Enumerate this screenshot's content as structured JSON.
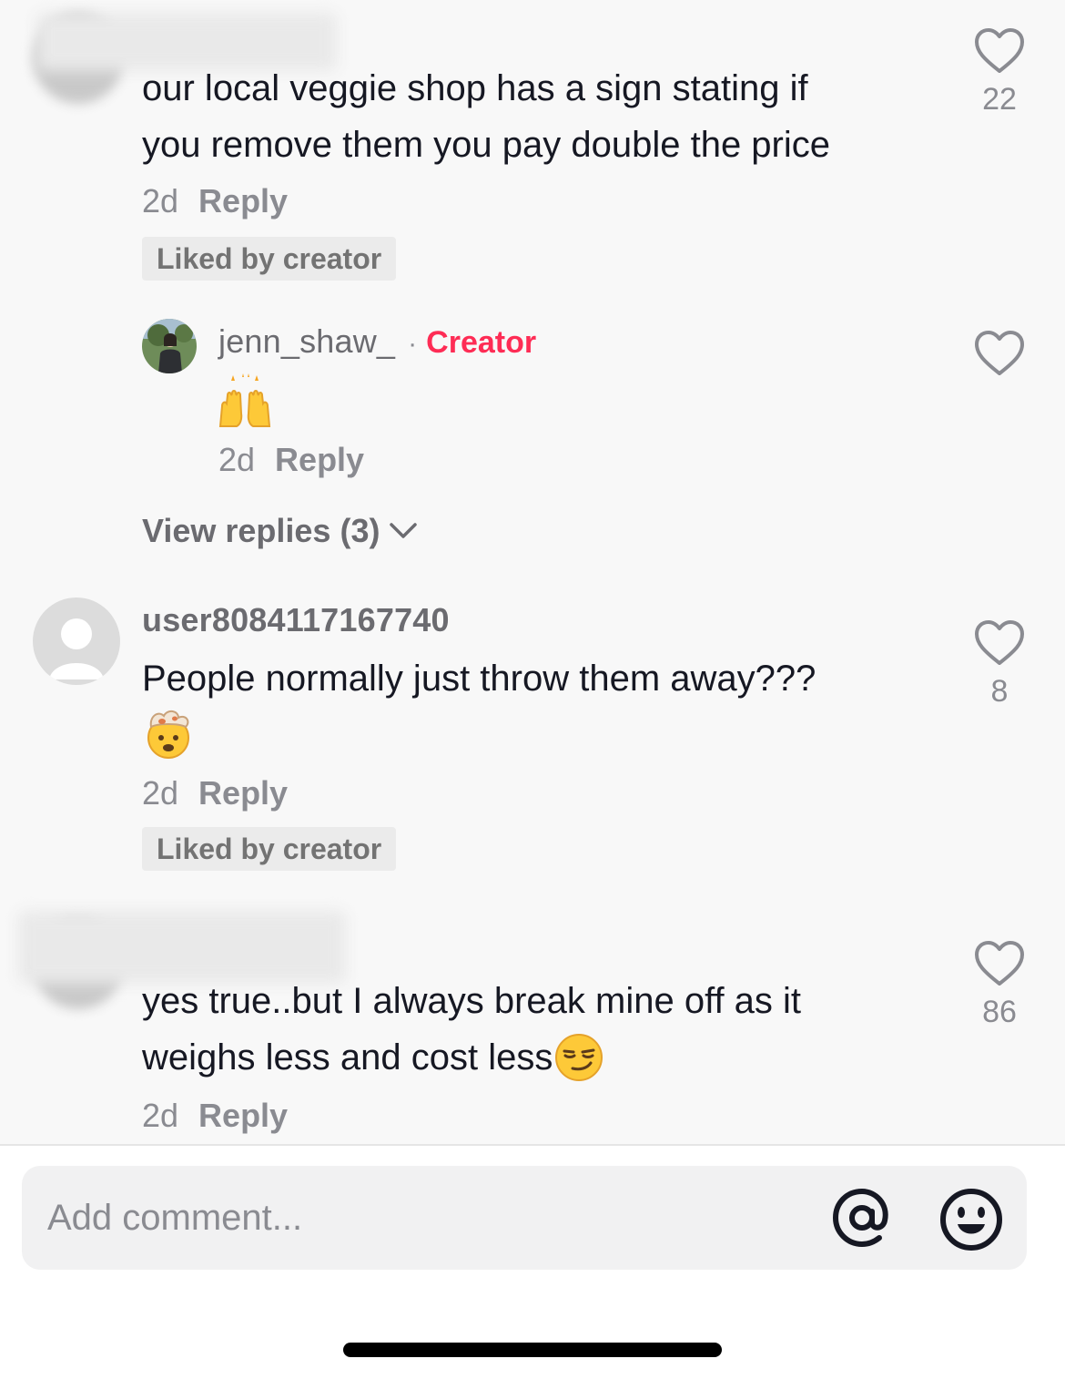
{
  "comments": [
    {
      "text_lines": [
        "our local veggie shop has a sign stating if",
        "you remove them you pay double the price"
      ],
      "time": "2d",
      "reply_label": "Reply",
      "liked_badge": "Liked by creator",
      "likes": "22"
    },
    {
      "username": "user8084117167740",
      "text": "People normally just throw them away???",
      "emoji": "exploding-head",
      "time": "2d",
      "reply_label": "Reply",
      "liked_badge": "Liked by creator",
      "likes": "8"
    },
    {
      "text_lines": [
        "yes true..but I always break mine off as it",
        "weighs less and cost less"
      ],
      "emoji": "smirking-face",
      "time": "2d",
      "reply_label": "Reply",
      "likes": "86"
    }
  ],
  "creator_reply": {
    "username": "jenn_shaw_",
    "separator": "·",
    "creator_tag": "Creator",
    "emoji": "raising-hands",
    "time": "2d",
    "reply_label": "Reply"
  },
  "view_replies": "View replies (3)",
  "composer": {
    "placeholder": "Add comment...",
    "mention_icon": "at-icon",
    "emoji_icon": "emoji-face-icon"
  },
  "colors": {
    "creator_accent": "#fe2c55",
    "text_primary": "#161823",
    "text_secondary": "#8a8b91"
  }
}
